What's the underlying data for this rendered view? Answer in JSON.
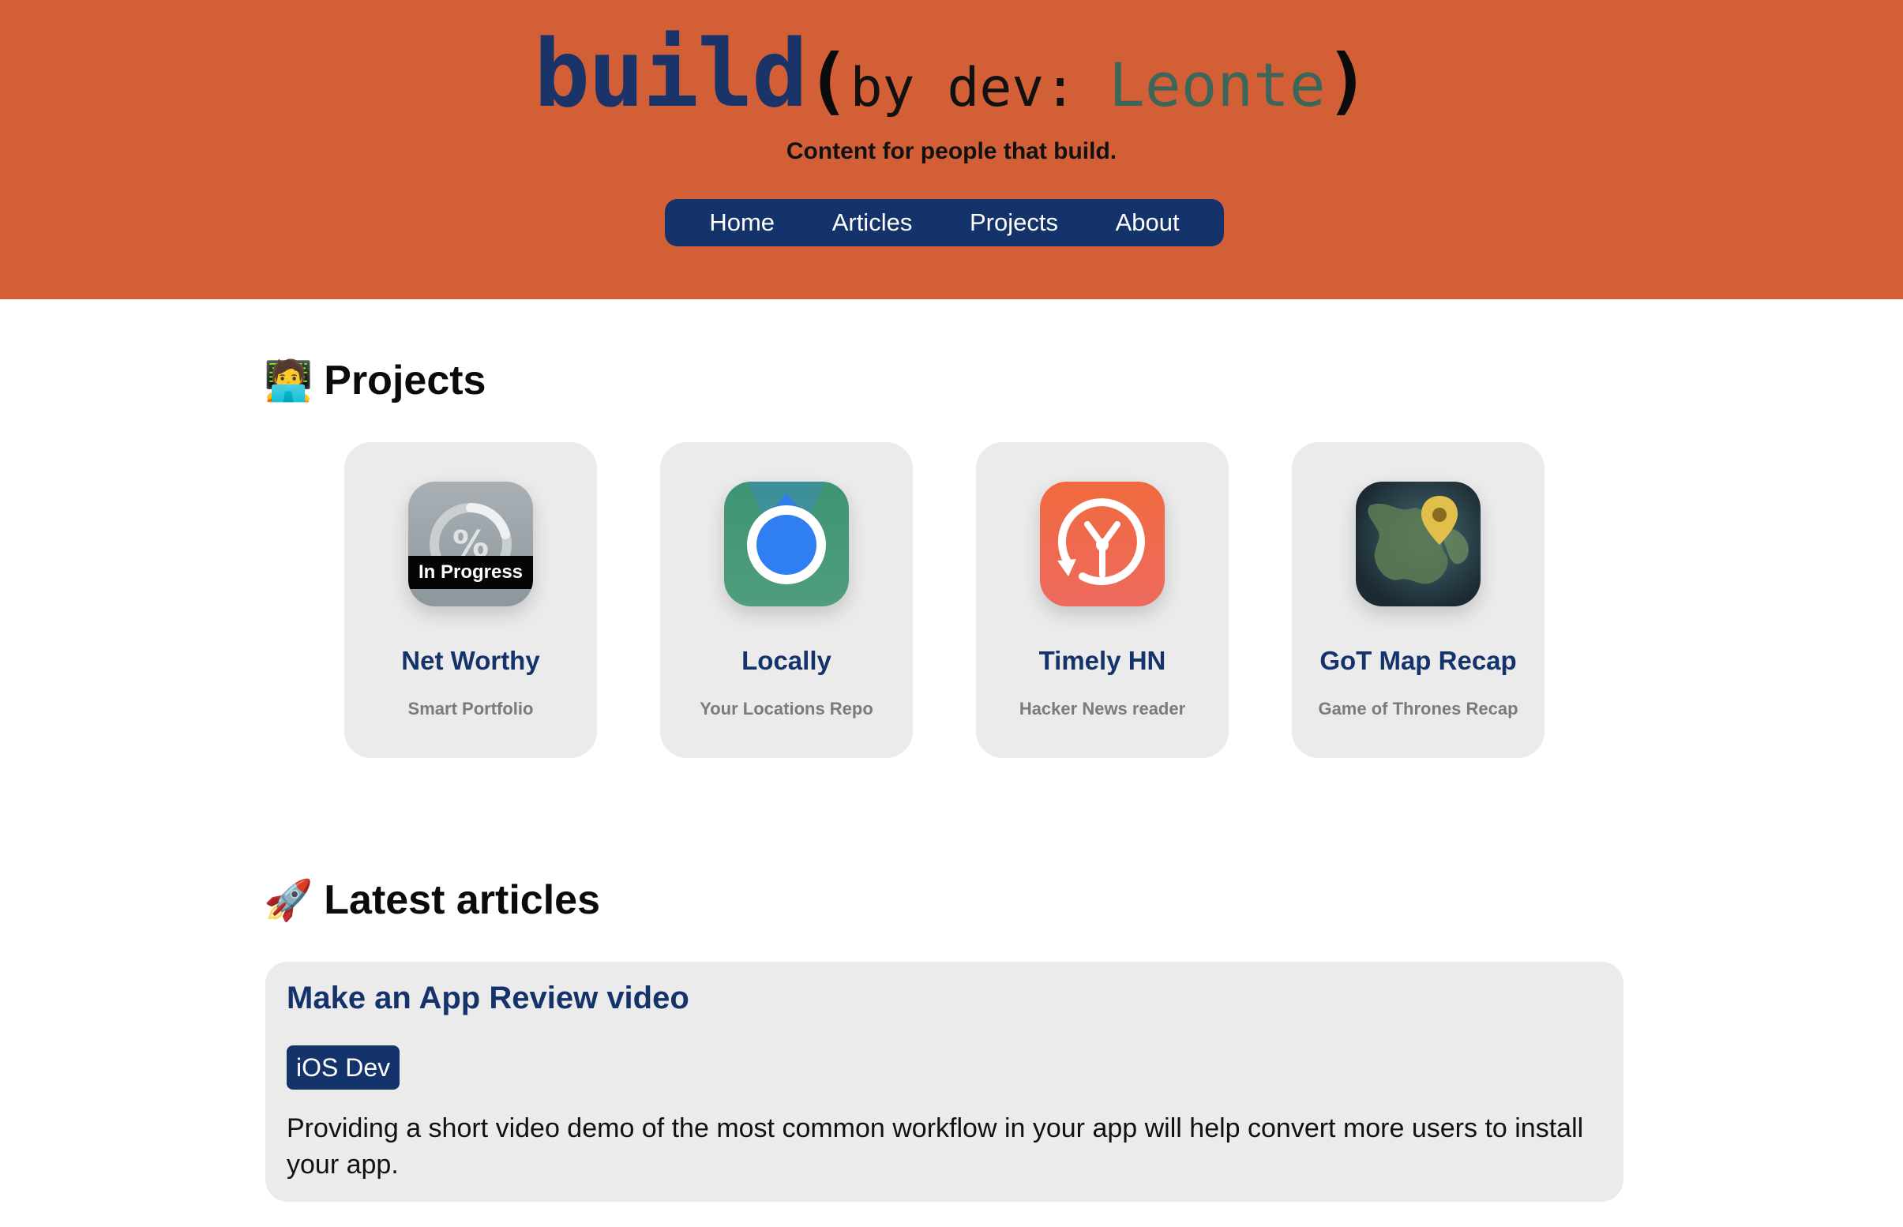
{
  "header": {
    "logo_build": "build",
    "logo_open_paren": "(",
    "logo_by": "by dev: ",
    "logo_name": "Leonte",
    "logo_close_paren": ")",
    "tagline": "Content for people that build.",
    "nav": [
      {
        "label": "Home"
      },
      {
        "label": "Articles"
      },
      {
        "label": "Projects"
      },
      {
        "label": "About"
      }
    ]
  },
  "projects_section": {
    "emoji": "🧑‍💻",
    "heading": "Projects",
    "items": [
      {
        "title": "Net Worthy",
        "subtitle": "Smart Portfolio",
        "icon": "percent-progress-icon",
        "badge": "In Progress",
        "color": "#9aa2a7"
      },
      {
        "title": "Locally",
        "subtitle": "Your Locations Repo",
        "icon": "location-dot-icon",
        "color": "#3f9071"
      },
      {
        "title": "Timely HN",
        "subtitle": "Hacker News reader",
        "icon": "clock-icon",
        "color": "#ee6a48"
      },
      {
        "title": "GoT Map Recap",
        "subtitle": "Game of Thrones Recap",
        "icon": "map-pin-icon",
        "color": "#2c4a5a"
      }
    ]
  },
  "articles_section": {
    "emoji": "🚀",
    "heading": "Latest articles",
    "items": [
      {
        "title": "Make an App Review video",
        "tag": "iOS Dev",
        "description": "Providing a short video demo of the most common workflow in your app will help convert more users to install your app."
      }
    ]
  },
  "colors": {
    "header_bg": "#d35f36",
    "brand_navy": "#15336b",
    "card_bg": "#ebebeb"
  }
}
